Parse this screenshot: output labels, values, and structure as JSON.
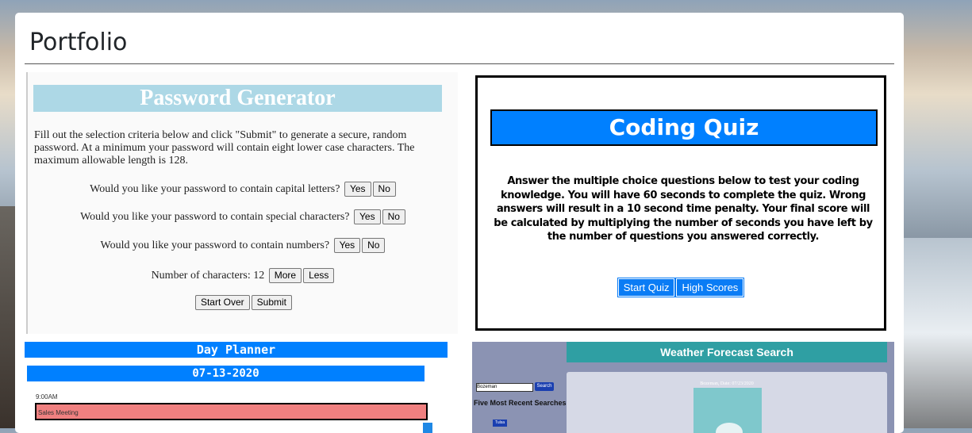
{
  "page": {
    "title": "Portfolio"
  },
  "password_generator": {
    "heading": "Password Generator",
    "intro": "Fill out the selection criteria below and click \"Submit\" to generate a secure, random password. At a minimum your password will contain eight lower case characters. The maximum allowable length is 128.",
    "q_caps": "Would you like your password to contain capital letters?",
    "q_special": "Would you like your password to contain special characters?",
    "q_numbers": "Would you like your password to contain numbers?",
    "yes": "Yes",
    "no": "No",
    "num_chars_label": "Number of characters: 12",
    "more": "More",
    "less": "Less",
    "start_over": "Start Over",
    "submit": "Submit"
  },
  "coding_quiz": {
    "heading": "Coding Quiz",
    "description": "Answer the multiple choice questions below to test your coding knowledge. You will have 60 seconds to complete the quiz. Wrong answers will result in a 10 second time penalty. Your final score will be calculated by multiplying the number of seconds you have left by the number of questions you answered correctly.",
    "start_quiz": "Start Quiz",
    "high_scores": "High Scores"
  },
  "day_planner": {
    "heading": "Day Planner",
    "date": "07-13-2020",
    "time": "9:00AM",
    "entry": "Sales Meeting"
  },
  "weather": {
    "heading": "Weather Forecast Search",
    "search_value": "Bozeman",
    "search_button": "Search",
    "recent_label": "Five Most Recent Searches",
    "recent_city": "Tulsa",
    "city_date": "Bozeman, Date: 07/23/2020"
  },
  "colors": {
    "quiz_blue": "#0080ff",
    "pw_header": "#add8e6",
    "weather_teal": "#2f9fa3",
    "planner_slot": "#f08080"
  }
}
